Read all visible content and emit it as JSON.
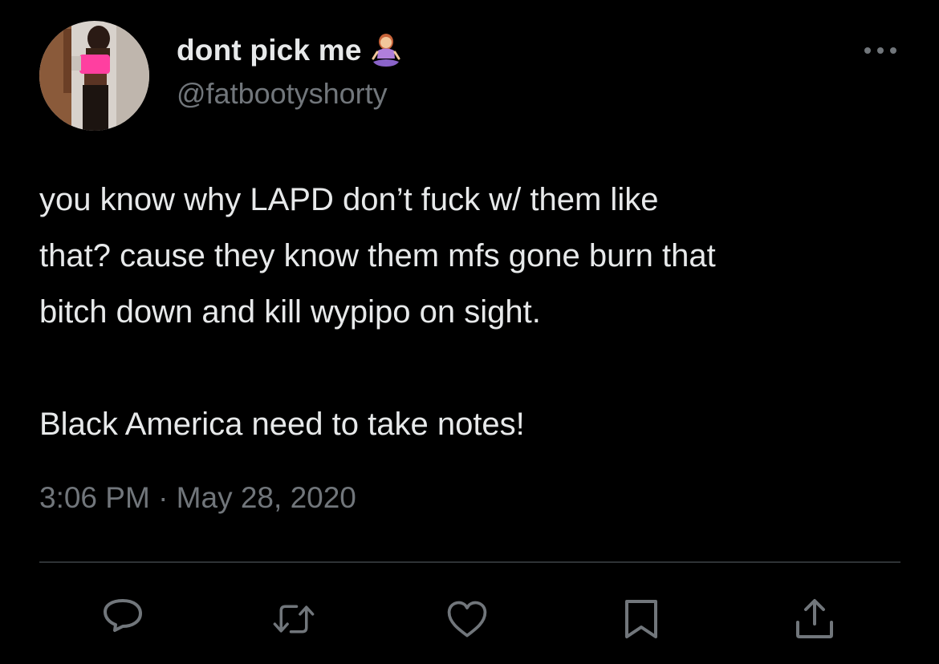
{
  "author": {
    "display_name": "dont pick me",
    "name_emoji": "person-in-lotus-position-emoji",
    "handle": "@fatbootyshorty"
  },
  "tweet": {
    "text": "you know why LAPD don’t fuck w/ them like\nthat? cause they know them mfs gone burn that\nbitch down and kill wypipo on sight.\n\nBlack America need to take notes!",
    "timestamp": "3:06 PM · May 28, 2020"
  },
  "actions": [
    {
      "icon": "reply-icon"
    },
    {
      "icon": "retweet-icon"
    },
    {
      "icon": "like-icon"
    },
    {
      "icon": "bookmark-icon"
    },
    {
      "icon": "share-icon"
    }
  ],
  "colors": {
    "background": "#000000",
    "primary_text": "#e7e9ea",
    "secondary_text": "#71767b",
    "divider": "#2f3336"
  }
}
